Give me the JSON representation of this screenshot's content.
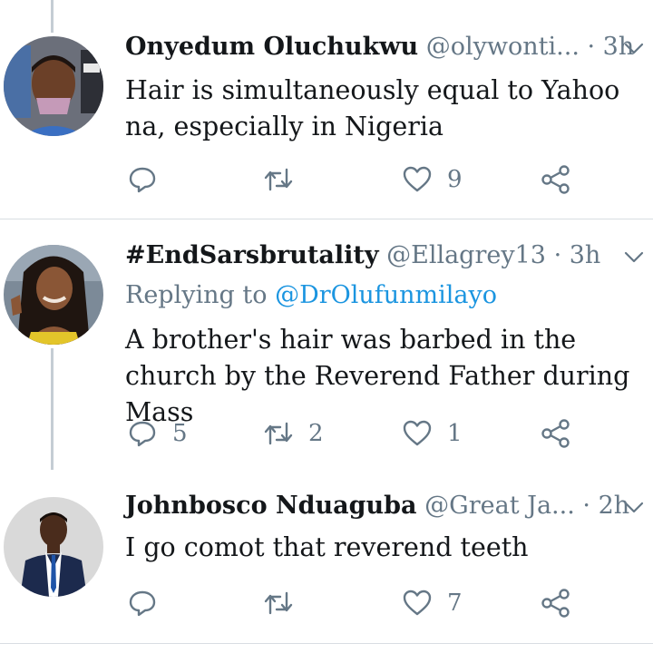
{
  "tweets": [
    {
      "name": "Onyedum Oluchukwu",
      "handle": "@olywonti...",
      "time": "· 3h",
      "reply_prefix": "",
      "reply_mention": "",
      "text": "Hair is simultaneously equal to Yahoo na, especially in Nigeria",
      "reply_count": "",
      "retweet_count": "",
      "like_count": "9"
    },
    {
      "name": "#EndSarsbrutality",
      "handle": "@Ellagrey13",
      "time": "· 3h",
      "reply_prefix": "Replying to ",
      "reply_mention": "@DrOlufunmilayo",
      "text": "A brother's hair was barbed in the church by the Reverend  Father during Mass",
      "reply_count": "5",
      "retweet_count": "2",
      "like_count": "1"
    },
    {
      "name": "Johnbosco Nduaguba",
      "handle": "@Great Ja...",
      "time": "· 2h",
      "reply_prefix": "",
      "reply_mention": "",
      "text": "I go comot that reverend teeth",
      "reply_count": "",
      "retweet_count": "",
      "like_count": "7"
    }
  ],
  "icons": {
    "reply": "reply-icon",
    "retweet": "retweet-icon",
    "like": "heart-icon",
    "share": "share-icon",
    "menu": "chevron-down-icon"
  },
  "colors": {
    "icon": "#657786",
    "mention": "#1b95e0",
    "divider": "#d8dde2"
  }
}
